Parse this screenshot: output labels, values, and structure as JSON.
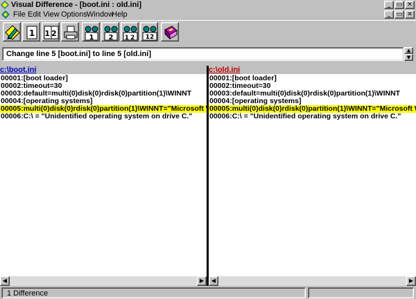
{
  "window": {
    "title": "Visual Difference - [boot.ini : old.ini]"
  },
  "caption_buttons": {
    "minimize": "_",
    "restore": "▭",
    "close": "✕"
  },
  "menu": [
    "File",
    "Edit",
    "View",
    "Options",
    "Window",
    "Help"
  ],
  "toolbar": {
    "buttons": [
      {
        "name": "compare-files-button",
        "icon": "pencil-diamond-icon"
      },
      {
        "name": "view-file-1-button",
        "icon": "one-document-icon",
        "label": "1"
      },
      {
        "name": "view-both-files-button",
        "icon": "two-documents-icon",
        "label": "12"
      },
      {
        "name": "print-button",
        "icon": "printer-icon"
      },
      {
        "name": "find-in-file-1-button",
        "icon": "binoculars-icon",
        "label": "1"
      },
      {
        "name": "find-in-file-2-button",
        "icon": "binoculars-icon",
        "label": "2"
      },
      {
        "name": "find-in-both-button",
        "icon": "binoculars-icon",
        "label": "12"
      },
      {
        "name": "find-diff-button",
        "icon": "binoculars-icon",
        "label": "12"
      },
      {
        "name": "help-button",
        "icon": "help-book-icon"
      }
    ]
  },
  "difference_selector": {
    "value": "Change line 5 [boot.ini] to line 5 [old.ini]"
  },
  "left_pane": {
    "path": "c:\\boot.ini",
    "path_color": "#0000c0",
    "lines": [
      {
        "text": "00001:[boot loader]",
        "diff": false
      },
      {
        "text": "00002:timeout=30",
        "diff": false
      },
      {
        "text": "00003:default=multi(0)disk(0)rdisk(0)partition(1)\\WINNT",
        "diff": false
      },
      {
        "text": "00004:[operating systems]",
        "diff": false
      },
      {
        "text": "00005:multi(0)disk(0)rdisk(0)partition(1)\\WINNT=\"Microsoft Wi",
        "diff": true
      },
      {
        "text": "00006:C:\\ = \"Unidentified operating system on drive C.\"",
        "diff": false
      }
    ]
  },
  "right_pane": {
    "path": "c:\\old.ini",
    "path_color": "#c00000",
    "lines": [
      {
        "text": "00001:[boot loader]",
        "diff": false
      },
      {
        "text": "00002:timeout=30",
        "diff": false
      },
      {
        "text": "00003:default=multi(0)disk(0)rdisk(0)partition(1)\\WINNT",
        "diff": false
      },
      {
        "text": "00004:[operating systems]",
        "diff": false
      },
      {
        "text": "00005:multi(0)disk(0)rdisk(0)partition(1)\\WINNT=\"Microsoft Wi",
        "diff": true
      },
      {
        "text": "00006:C:\\ = \"Unidentified operating system on drive C.\"",
        "diff": false
      }
    ]
  },
  "colors": {
    "diff_highlight": "#ffff00",
    "title_bar": "#c0c0c0"
  },
  "status_bar": {
    "message": "1 Difference"
  }
}
